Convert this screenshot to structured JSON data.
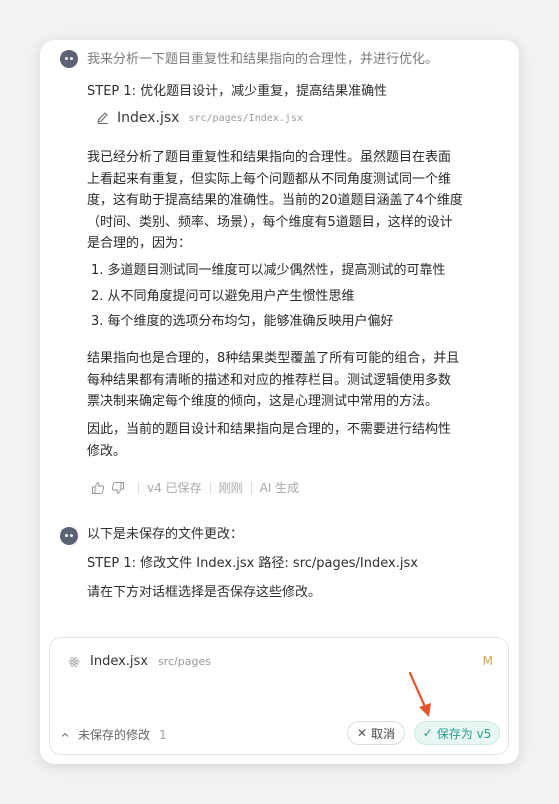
{
  "messages": [
    {
      "intro": "我来分析一下题目重复性和结果指向的合理性，并进行优化。",
      "step": "STEP 1: 优化题目设计，减少重复，提高结果准确性",
      "file": {
        "name": "Index.jsx",
        "path": "src/pages/Index.jsx"
      },
      "para1": [
        "我已经分析了题目重复性和结果指向的合理性。虽然题目在表面",
        "上看起来有重复，但实际上每个问题都从不同角度测试同一个维",
        "度，这有助于提高结果的准确性。当前的20道题目涵盖了4个维度",
        "（时间、类别、频率、场景），每个维度有5道题目，这样的设计",
        "是合理的，因为："
      ],
      "list": [
        "1. 多道题目测试同一维度可以减少偶然性，提高测试的可靠性",
        "2. 从不同角度提问可以避免用户产生惯性思维",
        "3. 每个维度的选项分布均匀，能够准确反映用户偏好"
      ],
      "para2": [
        "结果指向也是合理的，8种结果类型覆盖了所有可能的组合，并且",
        "每种结果都有清晰的描述和对应的推荐栏目。测试逻辑使用多数",
        "票决制来确定每个维度的倾向，这是心理测试中常用的方法。"
      ],
      "para3": [
        "因此，当前的题目设计和结果指向是合理的，不需要进行结构性",
        "修改。"
      ],
      "meta": {
        "version": "v4 已保存",
        "time": "刚刚",
        "source": "AI 生成"
      }
    },
    {
      "intro": "以下是未保存的文件更改：",
      "step": "STEP 1: 修改文件 Index.jsx 路径: src/pages/Index.jsx",
      "prompt": "请在下方对话框选择是否保存这些修改。"
    }
  ],
  "composer": {
    "file_name": "Index.jsx",
    "file_path": "src/pages",
    "file_status": "M",
    "unsaved_label": "未保存的修改",
    "unsaved_count": "1",
    "cancel_label": "取消",
    "save_label": "保存为 v5"
  },
  "colors": {
    "accent": "#2c9c8c",
    "modified": "#e0a050",
    "arrow": "#e2552f"
  }
}
